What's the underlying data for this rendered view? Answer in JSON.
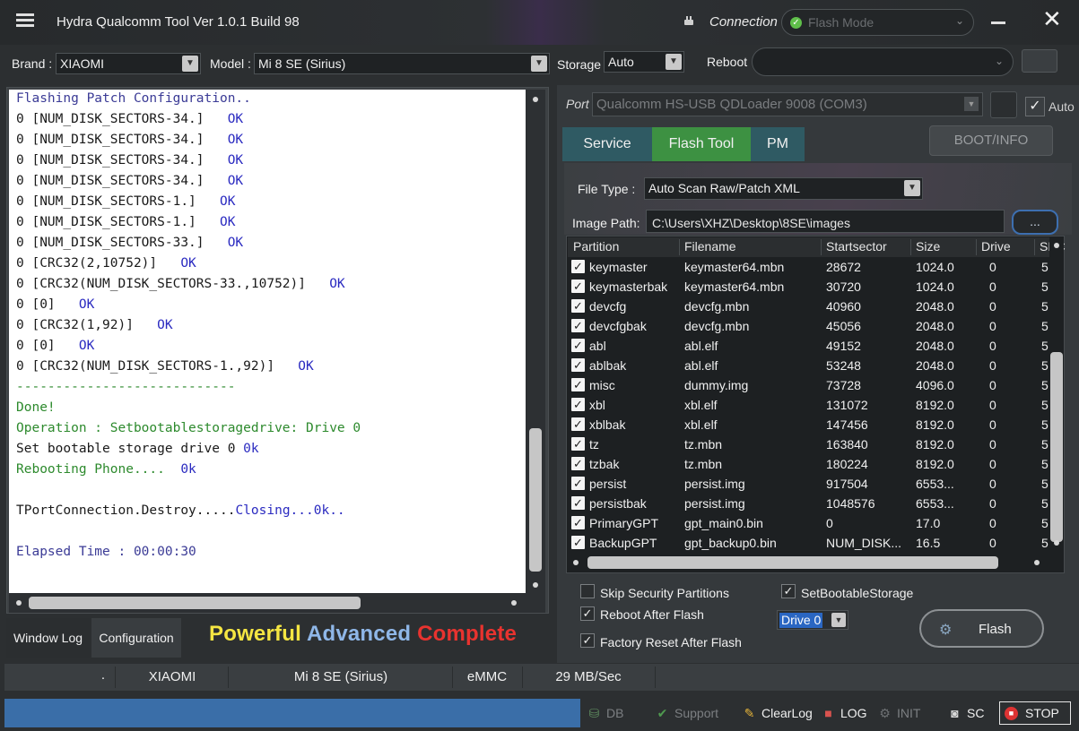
{
  "window": {
    "title": "Hydra Qualcomm  Tool  Ver 1.0.1 Build 98",
    "connection_label": "Connection",
    "connection_value": "Flash Mode"
  },
  "toolbar": {
    "brand_label": "Brand :",
    "brand_value": "XIAOMI",
    "model_label": "Model :",
    "model_value": "Mi 8 SE (Sirius)",
    "storage_label": "Storage",
    "storage_value": "Auto",
    "reboot_label": "Reboot",
    "reboot_value": ""
  },
  "log": {
    "lines": [
      {
        "text": "Flashing Patch Configuration..",
        "ok": "",
        "color": "blue"
      },
      {
        "text": "0 [NUM_DISK_SECTORS-34.]   ",
        "ok": "OK",
        "color": "dark"
      },
      {
        "text": "0 [NUM_DISK_SECTORS-34.]   ",
        "ok": "OK",
        "color": "dark"
      },
      {
        "text": "0 [NUM_DISK_SECTORS-34.]   ",
        "ok": "OK",
        "color": "dark"
      },
      {
        "text": "0 [NUM_DISK_SECTORS-34.]   ",
        "ok": "OK",
        "color": "dark"
      },
      {
        "text": "0 [NUM_DISK_SECTORS-1.]   ",
        "ok": "OK",
        "color": "dark"
      },
      {
        "text": "0 [NUM_DISK_SECTORS-1.]   ",
        "ok": "OK",
        "color": "dark"
      },
      {
        "text": "0 [NUM_DISK_SECTORS-33.]   ",
        "ok": "OK",
        "color": "dark"
      },
      {
        "text": "0 [CRC32(2,10752)]   ",
        "ok": "OK",
        "color": "dark"
      },
      {
        "text": "0 [CRC32(NUM_DISK_SECTORS-33.,10752)]   ",
        "ok": "OK",
        "color": "dark"
      },
      {
        "text": "0 [0]   ",
        "ok": "OK",
        "color": "dark"
      },
      {
        "text": "0 [CRC32(1,92)]   ",
        "ok": "OK",
        "color": "dark"
      },
      {
        "text": "0 [0]   ",
        "ok": "OK",
        "color": "dark"
      },
      {
        "text": "0 [CRC32(NUM_DISK_SECTORS-1.,92)]   ",
        "ok": "OK",
        "color": "dark"
      },
      {
        "text": "----------------------------",
        "ok": "",
        "color": "green"
      },
      {
        "text": "Done!",
        "ok": "",
        "color": "green"
      },
      {
        "text": "Operation : Setbootablestoragedrive: Drive 0",
        "ok": "",
        "color": "green"
      },
      {
        "text": "Set bootable storage drive 0 ",
        "ok": "0k",
        "color": "dark"
      },
      {
        "text": "Rebooting Phone....  ",
        "ok": "0k",
        "color": "green"
      },
      {
        "text": "",
        "ok": "",
        "color": "dark"
      },
      {
        "text": "TPortConnection.Destroy.....",
        "ok": "Closing...0k..",
        "color": "dark"
      },
      {
        "text": "",
        "ok": "",
        "color": "dark"
      },
      {
        "text": "Elapsed Time : 00:00:30",
        "ok": "",
        "color": "blue"
      }
    ]
  },
  "left_tabs": {
    "window_log": "Window Log",
    "configuration": "Configuration"
  },
  "slogan": {
    "word1": "Powerful",
    "word2": "Advanced",
    "word3": "Complete",
    "color1": "#f5e642",
    "color2": "#8fb7e8",
    "color3": "#e8332f"
  },
  "port": {
    "label": "Port",
    "value": "Qualcomm HS-USB QDLoader 9008 (COM3)",
    "auto_label": "Auto"
  },
  "right_tabs": {
    "service": "Service",
    "flash_tool": "Flash Tool",
    "pm": "PM",
    "boot_info": "BOOT/INFO"
  },
  "flash_tool": {
    "file_type_label": "File Type :",
    "file_type_value": "Auto Scan Raw/Patch XML",
    "image_path_label": "Image Path:",
    "image_path_value": "C:\\Users\\XHZ\\Desktop\\8SE\\images",
    "browse_label": "..."
  },
  "partition_table": {
    "headers": [
      "Partition",
      "Filename",
      "Startsector",
      "Size",
      "Drive",
      "SEC"
    ],
    "rows": [
      {
        "partition": "keymaster",
        "filename": "keymaster64.mbn",
        "start": "28672",
        "size": "1024.0",
        "drive": "0",
        "sec": "5"
      },
      {
        "partition": "keymasterbak",
        "filename": "keymaster64.mbn",
        "start": "30720",
        "size": "1024.0",
        "drive": "0",
        "sec": "5"
      },
      {
        "partition": "devcfg",
        "filename": "devcfg.mbn",
        "start": "40960",
        "size": "2048.0",
        "drive": "0",
        "sec": "5"
      },
      {
        "partition": "devcfgbak",
        "filename": "devcfg.mbn",
        "start": "45056",
        "size": "2048.0",
        "drive": "0",
        "sec": "5"
      },
      {
        "partition": "abl",
        "filename": "abl.elf",
        "start": "49152",
        "size": "2048.0",
        "drive": "0",
        "sec": "5"
      },
      {
        "partition": "ablbak",
        "filename": "abl.elf",
        "start": "53248",
        "size": "2048.0",
        "drive": "0",
        "sec": "5"
      },
      {
        "partition": "misc",
        "filename": "dummy.img",
        "start": "73728",
        "size": "4096.0",
        "drive": "0",
        "sec": "5"
      },
      {
        "partition": "xbl",
        "filename": "xbl.elf",
        "start": "131072",
        "size": "8192.0",
        "drive": "0",
        "sec": "5"
      },
      {
        "partition": "xblbak",
        "filename": "xbl.elf",
        "start": "147456",
        "size": "8192.0",
        "drive": "0",
        "sec": "5"
      },
      {
        "partition": "tz",
        "filename": "tz.mbn",
        "start": "163840",
        "size": "8192.0",
        "drive": "0",
        "sec": "5"
      },
      {
        "partition": "tzbak",
        "filename": "tz.mbn",
        "start": "180224",
        "size": "8192.0",
        "drive": "0",
        "sec": "5"
      },
      {
        "partition": "persist",
        "filename": "persist.img",
        "start": "917504",
        "size": "6553...",
        "drive": "0",
        "sec": "5"
      },
      {
        "partition": "persistbak",
        "filename": "persist.img",
        "start": "1048576",
        "size": "6553...",
        "drive": "0",
        "sec": "5"
      },
      {
        "partition": "PrimaryGPT",
        "filename": "gpt_main0.bin",
        "start": "0",
        "size": "17.0",
        "drive": "0",
        "sec": "5"
      },
      {
        "partition": "BackupGPT",
        "filename": "gpt_backup0.bin",
        "start": "NUM_DISK...",
        "size": "16.5",
        "drive": "0",
        "sec": "5"
      }
    ]
  },
  "options": {
    "skip_security": "Skip Security Partitions",
    "set_bootable": "SetBootableStorage",
    "reboot_after": "Reboot After Flash",
    "factory_reset": "Factory Reset After Flash",
    "drive_value": "Drive 0",
    "flash_button": "Flash"
  },
  "status_bar": {
    "dot": ".",
    "brand": "XIAOMI",
    "model": "Mi 8 SE (Sirius)",
    "storage": "eMMC",
    "speed": "29 MB/Sec"
  },
  "bottom_bar": {
    "db": "DB",
    "support": "Support",
    "clearlog": "ClearLog",
    "log": "LOG",
    "init": "INIT",
    "sc": "SC",
    "stop": "STOP",
    "colors": {
      "dim": "#7c7f82",
      "bright": "#f0f0f0"
    }
  }
}
